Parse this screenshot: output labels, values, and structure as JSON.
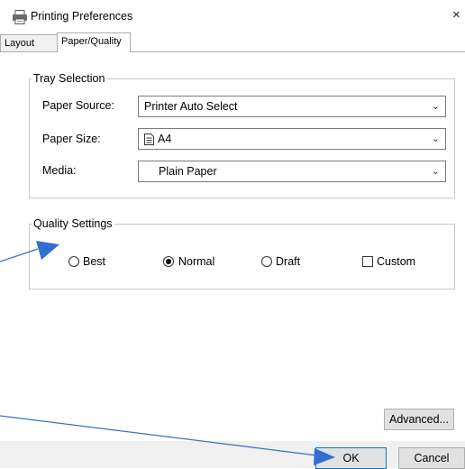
{
  "window": {
    "title": "Printing Preferences",
    "close_glyph": "×"
  },
  "tabs": [
    {
      "label": "Layout"
    },
    {
      "label": "Paper/Quality"
    }
  ],
  "tray_selection": {
    "legend": "Tray Selection",
    "paper_source": {
      "label": "Paper Source:",
      "value": "Printer Auto Select"
    },
    "paper_size": {
      "label": "Paper Size:",
      "value": "A4",
      "icon": "document-icon"
    },
    "media": {
      "label": "Media:",
      "value": "Plain Paper"
    }
  },
  "quality_settings": {
    "legend": "Quality Settings",
    "options": [
      {
        "label": "Best",
        "selected": false
      },
      {
        "label": "Normal",
        "selected": true
      },
      {
        "label": "Draft",
        "selected": false
      }
    ],
    "custom": {
      "label": "Custom",
      "checked": false
    }
  },
  "buttons": {
    "advanced": "Advanced...",
    "ok": "OK",
    "cancel": "Cancel"
  },
  "colors": {
    "arrow": "#3a6fc4"
  }
}
